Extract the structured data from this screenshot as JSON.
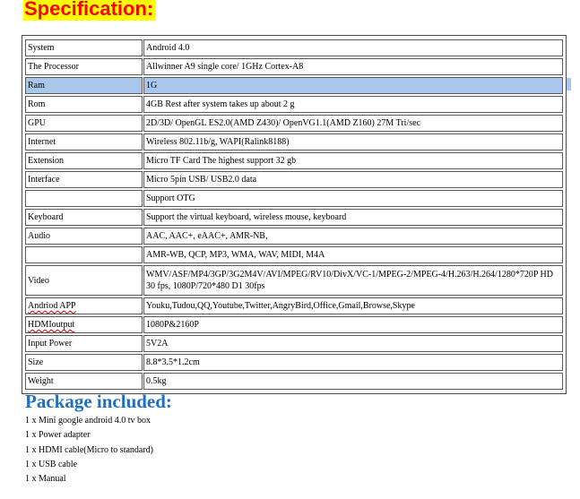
{
  "spec_title": "Specification:",
  "rows": [
    {
      "key": "System",
      "value": "Android 4.0"
    },
    {
      "key": "The Processor",
      "value": "Allwinner A9 single core/ 1GHz Cortex-A8"
    },
    {
      "key": "Ram",
      "value": "1G"
    },
    {
      "key": "Rom",
      "value": "4GB Rest after system takes up about 2 g"
    },
    {
      "key": "GPU",
      "value": "2D/3D/ OpenGL ES2.0(AMD Z430)/ OpenVG1.1(AMD Z160) 27M Tri/sec"
    },
    {
      "key": "Internet",
      "value": "Wireless 802.11b/g, WAPI(Ralink8188)"
    },
    {
      "key": "Extension",
      "value": "Micro TF Card  The highest support 32 gb"
    },
    {
      "key": "Interface",
      "value": "Micro 5pin USB/ USB2.0 data"
    },
    {
      "key": "",
      "value": "Support OTG"
    },
    {
      "key": "Keyboard",
      "value": "Support the virtual keyboard, wireless mouse, keyboard"
    },
    {
      "key": "Audio",
      "value": "AAC, AAC+, eAAC+, AMR-NB,"
    },
    {
      "key": "",
      "value": "AMR-WB, QCP, MP3, WMA, WAV, MIDI, M4A"
    },
    {
      "key": "Video",
      "value": "WMV/ASF/MP4/3GP/3G2M4V/AVI/MPEG/RV10/DivX/VC-1/MPEG-2/MPEG-4/H.263/H.264/1280*720P HD 30 fps, 1080P/720*480 D1 30fps"
    },
    {
      "key": "Andriod APP",
      "value": "Youku,Tudou,QQ,Youtube,Twitter,AngryBird,Office,Gmail,Browse,Skype"
    },
    {
      "key": "HDMIoutput",
      "value": "1080P&2160P"
    },
    {
      "key": "Input Power",
      "value": "5V2A"
    },
    {
      "key": "Size",
      "value": "8.8*3.5*1.2cm"
    },
    {
      "key": "Weight",
      "value": "0.5kg"
    }
  ],
  "package_title": "Package included:",
  "package_items": [
    "1 x Mini google android 4.0 tv box",
    "1 x Power adapter",
    "1 x HDMI cable(Micro to standard)",
    "1 x USB cable",
    "1 x Manual"
  ]
}
